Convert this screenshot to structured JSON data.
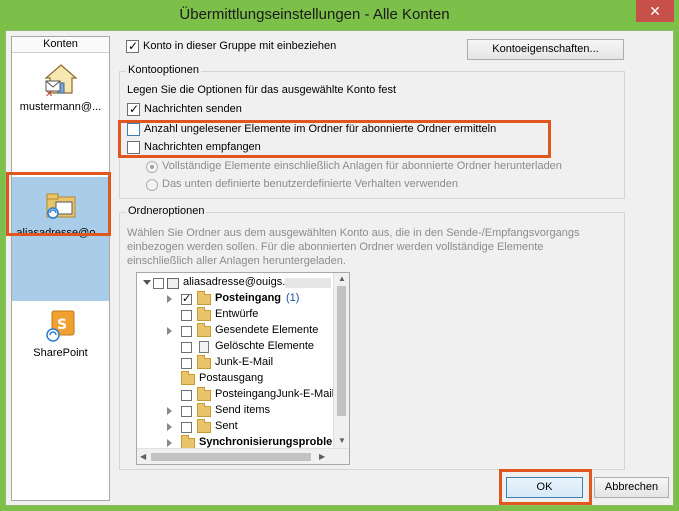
{
  "window": {
    "title": "Übermittlungseinstellungen - Alle Konten",
    "close_label": "✕"
  },
  "accounts": {
    "header": "Konten",
    "items": [
      {
        "label": "mustermann@..."
      },
      {
        "label": "aliasadresse@o..."
      },
      {
        "label": "SharePoint"
      }
    ]
  },
  "top": {
    "include_label": "Konto in dieser Gruppe mit einbeziehen",
    "properties_button": "Kontoeigenschaften..."
  },
  "account_options": {
    "title": "Kontooptionen",
    "description": "Legen Sie die Optionen für das ausgewählte Konto fest",
    "send_label": "Nachrichten senden",
    "unread_label": "Anzahl ungelesener Elemente im Ordner für abonnierte Ordner ermitteln",
    "receive_label": "Nachrichten empfangen",
    "radio_full": "Vollständige Elemente einschließlich Anlagen für abonnierte Ordner herunterladen",
    "radio_custom": "Das unten definierte benutzerdefinierte Verhalten verwenden"
  },
  "folder_options": {
    "title": "Ordneroptionen",
    "description_1": "Wählen Sie Ordner aus dem ausgewählten Konto aus, die in den Sende-/Empfangsvorgangs",
    "description_2": "einbezogen werden sollen. Für die abonnierten Ordner werden vollständige Elemente",
    "description_3": "einschließlich aller Anlagen heruntergeladen.",
    "tree": {
      "root": "aliasadresse@ouigs.",
      "inbox": "Posteingang",
      "inbox_count": "(1)",
      "drafts": "Entwürfe",
      "sent_items_de": "Gesendete Elemente",
      "deleted": "Gelöschte Elemente",
      "junk": "Junk-E-Mail",
      "outbox": "Postausgang",
      "inbox_junk": "PosteingangJunk-E-Mail",
      "send_items": "Send items",
      "sent": "Sent",
      "sync_problems": "Synchronisierungsprobleme"
    }
  },
  "buttons": {
    "ok": "OK",
    "cancel": "Abbrechen"
  },
  "colors": {
    "titlebar": "#7cc04a",
    "highlight": "#e0561f",
    "selected": "#a9cce8",
    "close": "#c7504a"
  }
}
